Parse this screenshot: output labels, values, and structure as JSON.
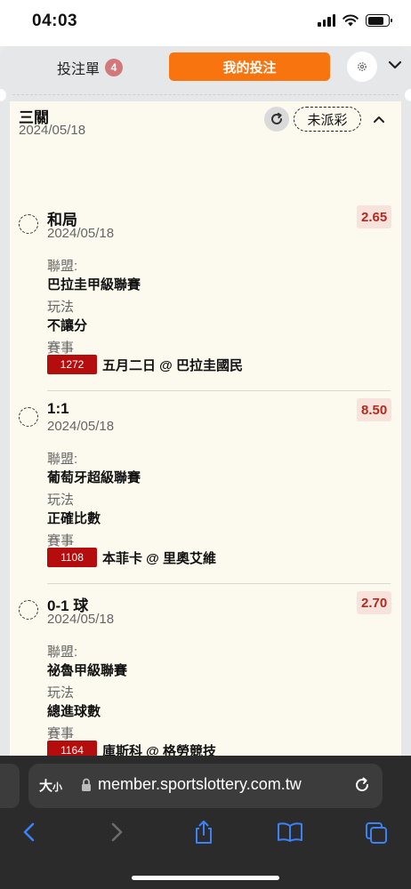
{
  "status_bar": {
    "time": "04:03",
    "battery_level": 0.8
  },
  "tabs": {
    "betslip_label": "投注單",
    "betslip_count": "4",
    "mybets_label": "我的投注"
  },
  "bet": {
    "type": "三關",
    "date": "2024/05/18",
    "status": "未派彩",
    "legs": [
      {
        "pick": "和局",
        "date": "2024/05/18",
        "odds": "2.65",
        "league_label": "聯盟:",
        "league": "巴拉圭甲級聯賽",
        "market_label": "玩法",
        "market": "不讓分",
        "match_label": "賽事",
        "match_code": "1272",
        "match": "五月二日 @ 巴拉圭國民"
      },
      {
        "pick": "1:1",
        "date": "2024/05/18",
        "odds": "8.50",
        "league_label": "聯盟:",
        "league": "葡萄牙超級聯賽",
        "market_label": "玩法",
        "market": "正確比數",
        "match_label": "賽事",
        "match_code": "1108",
        "match": "本菲卡 @ 里奧艾維"
      },
      {
        "pick": "0-1 球",
        "date": "2024/05/18",
        "odds": "2.70",
        "league_label": "聯盟:",
        "league": "祕魯甲級聯賽",
        "market_label": "玩法",
        "market": "總進球數",
        "match_label": "賽事",
        "match_code": "1164",
        "match": "庫斯科 @ 格勞競技"
      }
    ]
  },
  "browser": {
    "text_size_label": "大",
    "text_size_small": "小",
    "url": "member.sportslottery.com.tw"
  },
  "colors": {
    "accent": "#f7740f",
    "odds_text": "#b32a1f",
    "match_code_bg": "#b50d0d",
    "ios_blue": "#3b82f6"
  },
  "icons": {
    "settings": "gear-icon",
    "collapse": "chevron-down-icon",
    "refresh": "refresh-icon",
    "card_collapse": "chevron-up-icon",
    "lock": "lock-icon",
    "reload": "reload-icon",
    "back": "back-arrow-icon",
    "forward": "forward-arrow-icon",
    "share": "share-icon",
    "bookmarks": "bookmarks-icon",
    "tabs": "tabs-icon"
  }
}
